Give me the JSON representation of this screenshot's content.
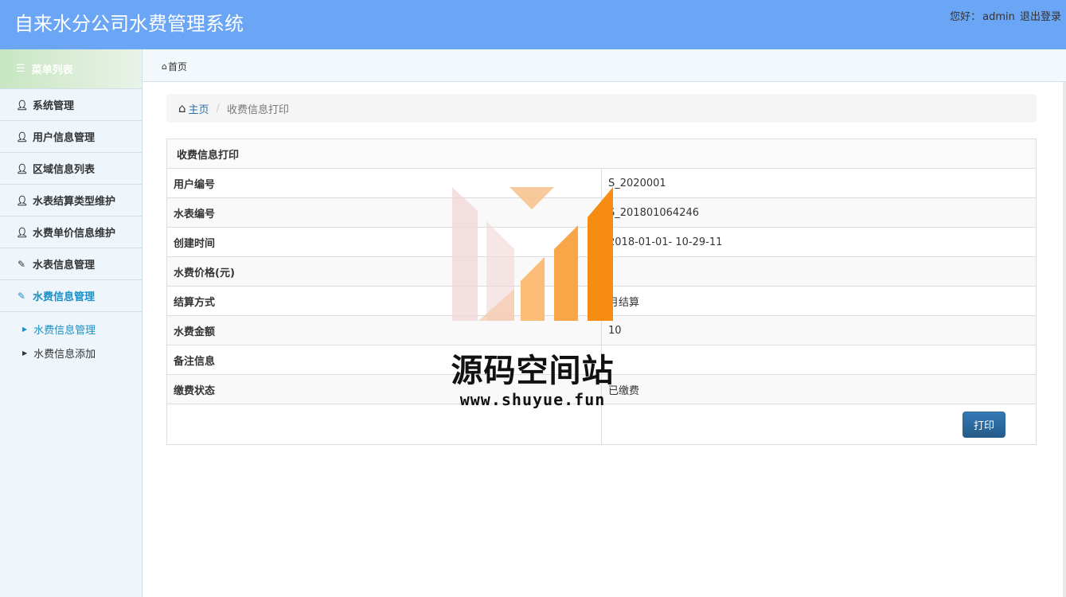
{
  "header": {
    "title": "自来水分公司水费管理系统",
    "greeting": "您好：",
    "username": "admin",
    "logout": "退出登录"
  },
  "sidebar": {
    "menu_title": "菜单列表",
    "items": [
      {
        "label": "系统管理",
        "icon": "user-icon"
      },
      {
        "label": "用户信息管理",
        "icon": "user-icon"
      },
      {
        "label": "区域信息列表",
        "icon": "user-icon"
      },
      {
        "label": "水表结算类型维护",
        "icon": "user-icon"
      },
      {
        "label": "水费单价信息维护",
        "icon": "user-icon"
      },
      {
        "label": "水表信息管理",
        "icon": "edit-icon"
      },
      {
        "label": "水费信息管理",
        "icon": "edit-icon",
        "active": true
      }
    ],
    "sub_items": [
      {
        "label": "水费信息管理",
        "active": true
      },
      {
        "label": "水费信息添加"
      }
    ]
  },
  "tabbar": {
    "home_tab": "首页"
  },
  "breadcrumb": {
    "home": "主页",
    "current": "收费信息打印"
  },
  "detail": {
    "caption": "收费信息打印",
    "rows": [
      {
        "label": "用户编号",
        "value": "S_2020001"
      },
      {
        "label": "水表编号",
        "value": "S_201801064246"
      },
      {
        "label": "创建时间",
        "value": "2018-01-01- 10-29-11"
      },
      {
        "label": "水费价格(元)",
        "value": ""
      },
      {
        "label": "结算方式",
        "value": "月结算"
      },
      {
        "label": "水费金额",
        "value": "10"
      },
      {
        "label": "备注信息",
        "value": ""
      },
      {
        "label": "缴费状态",
        "value": "已缴费"
      }
    ],
    "print_button": "打印"
  },
  "watermark": {
    "text": "源码空间站",
    "url": "www.shuyue.fun"
  },
  "colors": {
    "header_bg": "#6aa6f5",
    "accent": "#1a8fc7",
    "button": "#2d6ca2"
  }
}
